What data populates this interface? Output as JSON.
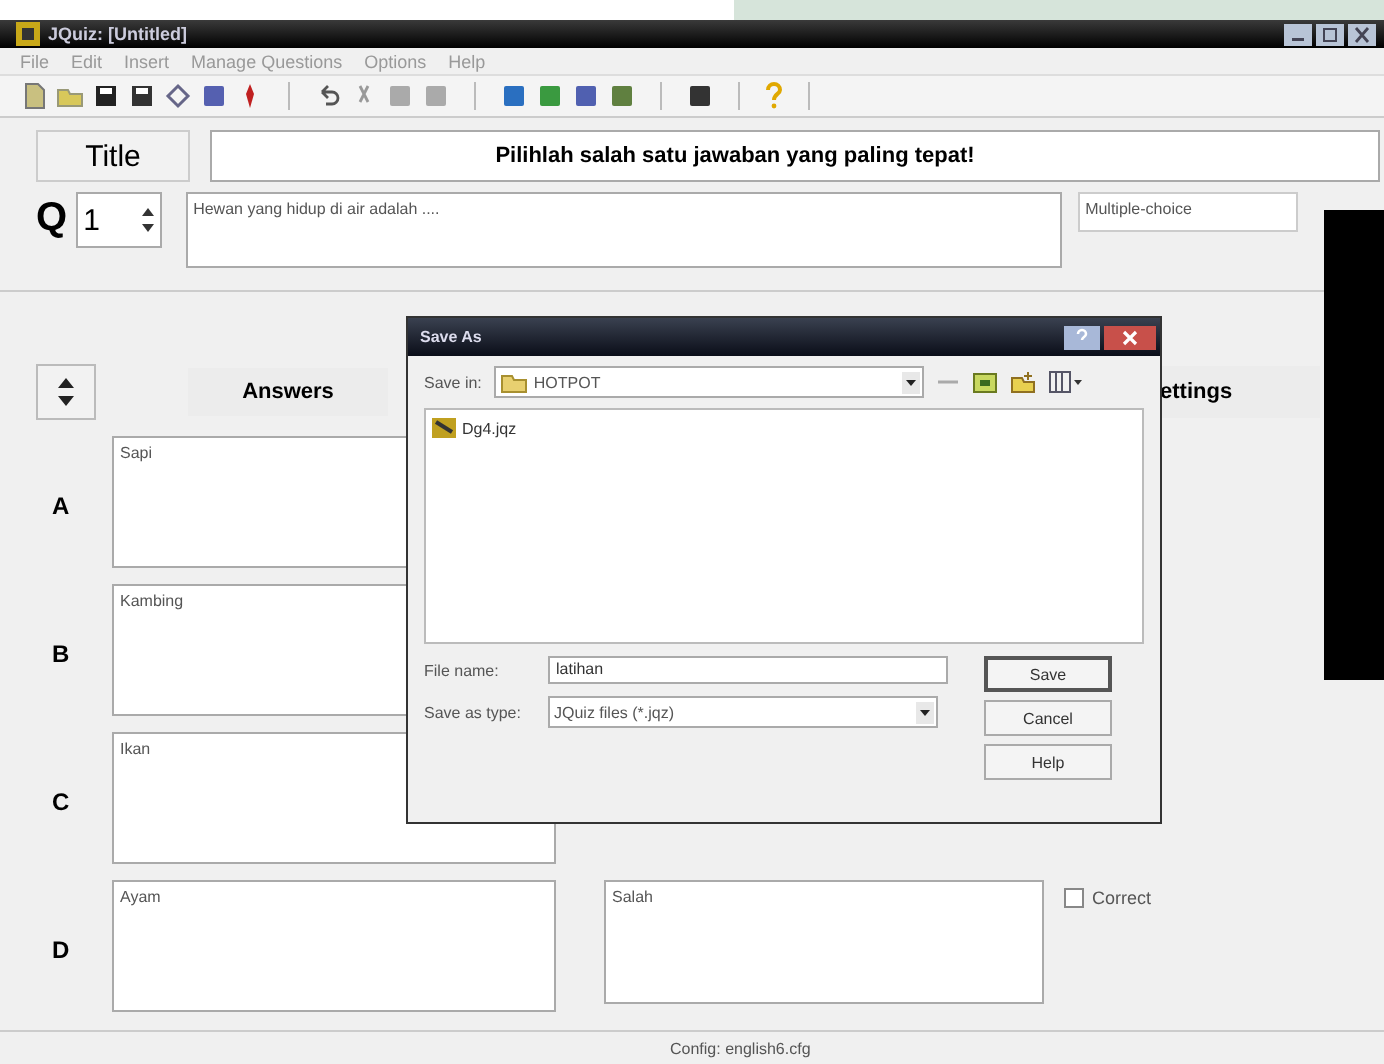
{
  "window": {
    "title": "JQuiz: [Untitled]"
  },
  "menu": [
    "File",
    "Edit",
    "Insert",
    "Manage Questions",
    "Options",
    "Help"
  ],
  "title_button": "Title",
  "quiz_title": "Pilihlah salah satu jawaban yang paling tepat!",
  "question": {
    "label": "Q",
    "number": "1",
    "text": "Hewan yang hidup di air adalah ....",
    "type": "Multiple-choice"
  },
  "answers_header": "Answers",
  "settings_header": "ettings",
  "answers": [
    {
      "letter": "A",
      "text": "Sapi"
    },
    {
      "letter": "B",
      "text": "Kambing"
    },
    {
      "letter": "C",
      "text": "Ikan"
    },
    {
      "letter": "D",
      "text": "Ayam",
      "feedback": "Salah",
      "correct_label": "Correct",
      "checked": false
    }
  ],
  "status_bar": "Config: english6.cfg",
  "dialog": {
    "title": "Save As",
    "save_in_label": "Save in:",
    "folder": "HOTPOT",
    "files": [
      {
        "name": "Dg4.jqz"
      }
    ],
    "file_name_label": "File name:",
    "file_name": "latihan",
    "type_label": "Save as type:",
    "type": "JQuiz files (*.jqz)",
    "buttons": [
      "Save",
      "Cancel",
      "Help"
    ]
  }
}
